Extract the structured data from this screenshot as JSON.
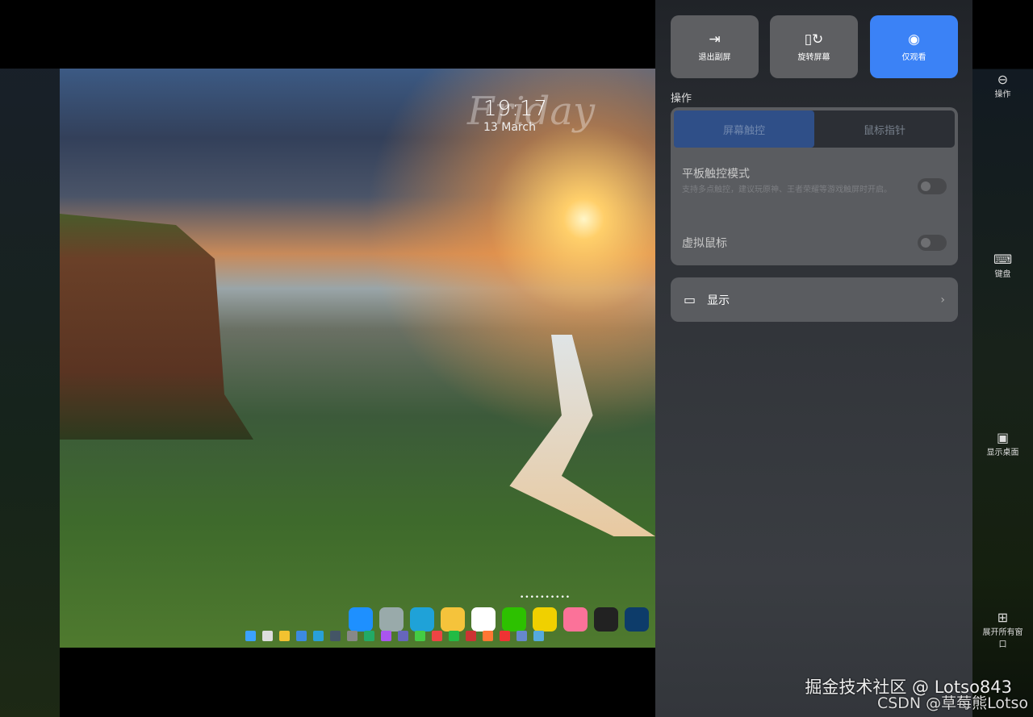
{
  "lockscreen": {
    "time": "19:17",
    "date": "13 March",
    "day": "Friday",
    "page_dots": "••••••••••"
  },
  "quick_actions": [
    {
      "label": "退出副屏",
      "icon": "exit-door-icon",
      "active": false
    },
    {
      "label": "旋转屏幕",
      "icon": "rotate-screen-icon",
      "active": false
    },
    {
      "label": "仅观看",
      "icon": "eye-icon",
      "active": true
    }
  ],
  "operation": {
    "section_label": "操作",
    "tabs": [
      "屏幕触控",
      "鼠标指针"
    ],
    "tablet_touch": {
      "title": "平板触控模式",
      "desc": "支持多点触控，建议玩原神、王者荣耀等游戏触屏时开启。",
      "enabled": false
    },
    "virtual_mouse": {
      "title": "虚拟鼠标",
      "enabled": false
    }
  },
  "display": {
    "label": "显示"
  },
  "sidebar": [
    {
      "label": "操作",
      "icon": "toggles-icon"
    },
    {
      "label": "键盘",
      "icon": "keyboard-icon"
    },
    {
      "label": "显示桌面",
      "icon": "desktop-icon"
    },
    {
      "label": "展开所有窗口",
      "icon": "grid-windows-icon"
    }
  ],
  "watermark": {
    "line1": "掘金技术社区 @ Lotso843",
    "line2": "CSDN @草莓熊Lotso"
  },
  "colors": {
    "accent": "#3b82f6"
  }
}
